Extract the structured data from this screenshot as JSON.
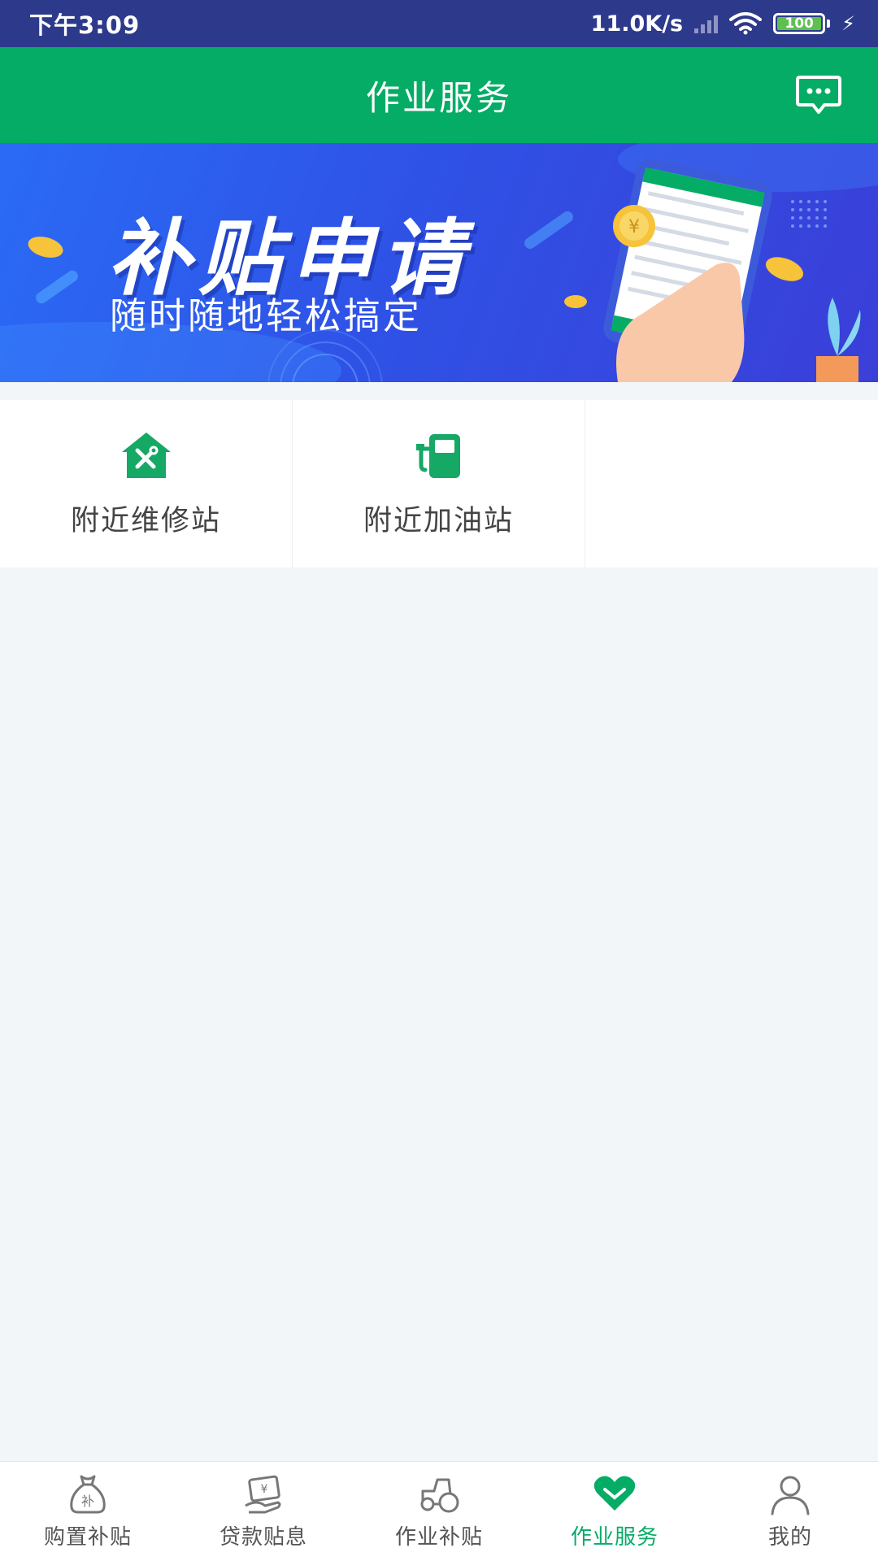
{
  "status_bar": {
    "time": "下午3:09",
    "network_speed": "11.0K/s",
    "battery": "100"
  },
  "header": {
    "title": "作业服务",
    "message_icon": "message-icon"
  },
  "banner": {
    "headline": "补贴申请",
    "subtitle": "随时随地轻松搞定"
  },
  "services": [
    {
      "label": "附近维修站",
      "icon": "repair-station-icon"
    },
    {
      "label": "附近加油站",
      "icon": "gas-station-icon"
    }
  ],
  "bottom_nav": {
    "active_color": "#05ac66",
    "items": [
      {
        "label": "购置补贴",
        "icon": "subsidy-bag-icon"
      },
      {
        "label": "贷款贴息",
        "icon": "loan-icon"
      },
      {
        "label": "作业补贴",
        "icon": "tractor-icon"
      },
      {
        "label": "作业服务",
        "icon": "heart-icon",
        "active": true
      },
      {
        "label": "我的",
        "icon": "user-icon"
      }
    ]
  },
  "colors": {
    "status_bar": "#2d3a8c",
    "header": "#05ac66",
    "page_bg": "#f2f6f8"
  }
}
